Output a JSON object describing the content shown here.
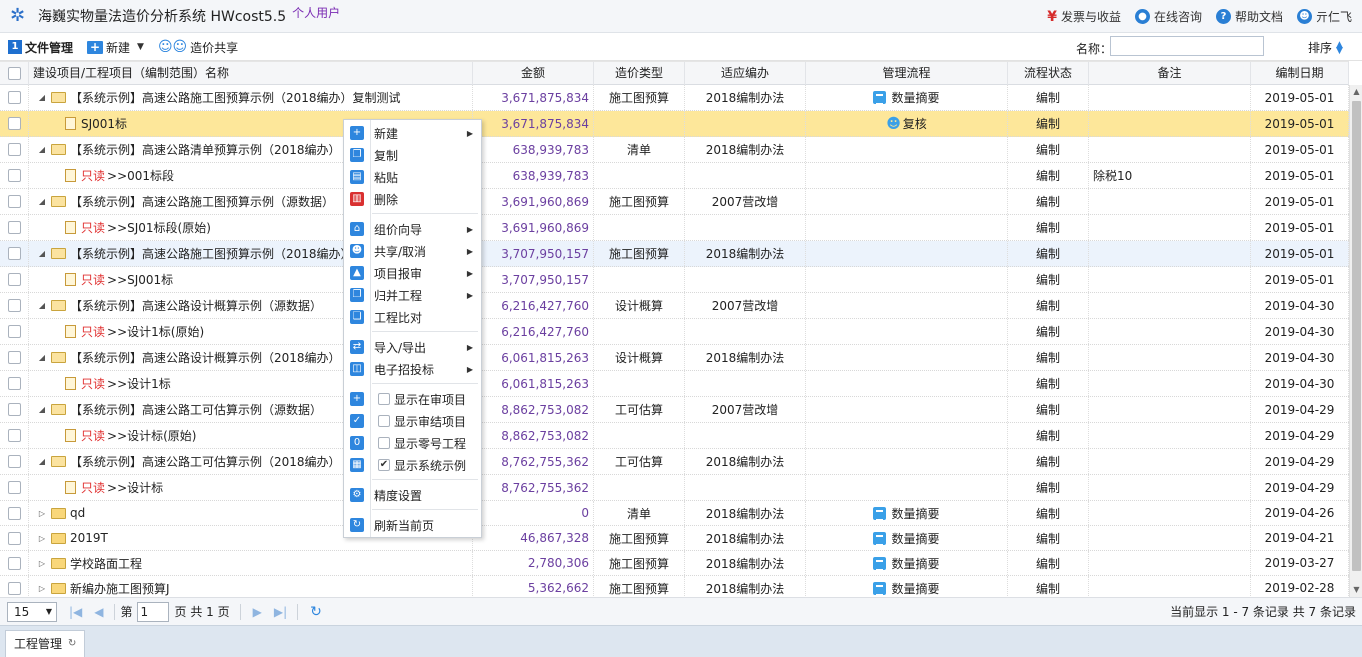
{
  "app": {
    "title": "海巍实物量法造价分析系统 HWcost5.5",
    "user_type": "个人用户",
    "links": [
      {
        "label": "发票与收益",
        "icon": "yen-icon"
      },
      {
        "label": "在线咨询",
        "icon": "chat-icon"
      },
      {
        "label": "帮助文档",
        "icon": "help-icon"
      },
      {
        "label": "亓仁飞",
        "icon": "user-icon"
      }
    ]
  },
  "toolbar": {
    "file_mgmt": "文件管理",
    "new": "新建",
    "share": "造价共享",
    "name_label": "名称：",
    "name_value": "",
    "sort": "排序"
  },
  "columns": {
    "name": "建设项目/工程项目（编制范围）名称",
    "amount": "金额",
    "type": "造价类型",
    "standard": "适应编办",
    "flow": "管理流程",
    "status": "流程状态",
    "note": "备注",
    "date": "编制日期"
  },
  "rows": [
    {
      "level": 0,
      "kind": "folder",
      "open": true,
      "ro": "",
      "name": "【系统示例】高速公路施工图预算示例（2018编办）复制测试",
      "amount": "3,671,875,834",
      "type": "施工图预算",
      "standard": "2018编制办法",
      "flow": "数量摘要",
      "flow_icon": "calc",
      "status": "编制",
      "note": "",
      "date": "2019-05-01"
    },
    {
      "level": 1,
      "kind": "doc",
      "open": false,
      "ro": "",
      "name": "SJ001标",
      "amount": "3,671,875,834",
      "type": "",
      "standard": "",
      "flow": "复核",
      "flow_icon": "user",
      "status": "编制",
      "note": "",
      "date": "2019-05-01",
      "selected": true
    },
    {
      "level": 0,
      "kind": "folder",
      "open": true,
      "ro": "",
      "name": "【系统示例】高速公路清单预算示例（2018编办）",
      "amount": "638,939,783",
      "type": "清单",
      "standard": "2018编制办法",
      "flow": "",
      "flow_icon": "",
      "status": "编制",
      "note": "",
      "date": "2019-05-01"
    },
    {
      "level": 1,
      "kind": "doc",
      "open": false,
      "ro": "只读",
      "name": ">>001标段",
      "amount": "638,939,783",
      "type": "",
      "standard": "",
      "flow": "",
      "flow_icon": "",
      "status": "编制",
      "note": "除税10",
      "date": "2019-05-01"
    },
    {
      "level": 0,
      "kind": "folder",
      "open": true,
      "ro": "",
      "name": "【系统示例】高速公路施工图预算示例（源数据）",
      "amount": "3,691,960,869",
      "type": "施工图预算",
      "standard": "2007营改增",
      "flow": "",
      "flow_icon": "",
      "status": "编制",
      "note": "",
      "date": "2019-05-01"
    },
    {
      "level": 1,
      "kind": "doc",
      "open": false,
      "ro": "只读",
      "name": ">>SJ01标段(原始)",
      "amount": "3,691,960,869",
      "type": "",
      "standard": "",
      "flow": "",
      "flow_icon": "",
      "status": "编制",
      "note": "",
      "date": "2019-05-01"
    },
    {
      "level": 0,
      "kind": "folder",
      "open": true,
      "ro": "",
      "name": "【系统示例】高速公路施工图预算示例（2018编办）",
      "amount": "3,707,950,157",
      "type": "施工图预算",
      "standard": "2018编制办法",
      "flow": "",
      "flow_icon": "",
      "status": "编制",
      "note": "",
      "date": "2019-05-01",
      "hover": true
    },
    {
      "level": 1,
      "kind": "doc",
      "open": false,
      "ro": "只读",
      "name": ">>SJ001标",
      "amount": "3,707,950,157",
      "type": "",
      "standard": "",
      "flow": "",
      "flow_icon": "",
      "status": "编制",
      "note": "",
      "date": "2019-05-01"
    },
    {
      "level": 0,
      "kind": "folder",
      "open": true,
      "ro": "",
      "name": "【系统示例】高速公路设计概算示例（源数据）",
      "amount": "6,216,427,760",
      "type": "设计概算",
      "standard": "2007营改增",
      "flow": "",
      "flow_icon": "",
      "status": "编制",
      "note": "",
      "date": "2019-04-30"
    },
    {
      "level": 1,
      "kind": "doc",
      "open": false,
      "ro": "只读",
      "name": ">>设计1标(原始)",
      "amount": "6,216,427,760",
      "type": "",
      "standard": "",
      "flow": "",
      "flow_icon": "",
      "status": "编制",
      "note": "",
      "date": "2019-04-30"
    },
    {
      "level": 0,
      "kind": "folder",
      "open": true,
      "ro": "",
      "name": "【系统示例】高速公路设计概算示例（2018编办）",
      "amount": "6,061,815,263",
      "type": "设计概算",
      "standard": "2018编制办法",
      "flow": "",
      "flow_icon": "",
      "status": "编制",
      "note": "",
      "date": "2019-04-30"
    },
    {
      "level": 1,
      "kind": "doc",
      "open": false,
      "ro": "只读",
      "name": ">>设计1标",
      "amount": "6,061,815,263",
      "type": "",
      "standard": "",
      "flow": "",
      "flow_icon": "",
      "status": "编制",
      "note": "",
      "date": "2019-04-30"
    },
    {
      "level": 0,
      "kind": "folder",
      "open": true,
      "ro": "",
      "name": "【系统示例】高速公路工可估算示例（源数据）",
      "amount": "8,862,753,082",
      "type": "工可估算",
      "standard": "2007营改增",
      "flow": "",
      "flow_icon": "",
      "status": "编制",
      "note": "",
      "date": "2019-04-29"
    },
    {
      "level": 1,
      "kind": "doc",
      "open": false,
      "ro": "只读",
      "name": ">>设计标(原始)",
      "amount": "8,862,753,082",
      "type": "",
      "standard": "",
      "flow": "",
      "flow_icon": "",
      "status": "编制",
      "note": "",
      "date": "2019-04-29"
    },
    {
      "level": 0,
      "kind": "folder",
      "open": true,
      "ro": "",
      "name": "【系统示例】高速公路工可估算示例（2018编办）",
      "amount": "8,762,755,362",
      "type": "工可估算",
      "standard": "2018编制办法",
      "flow": "",
      "flow_icon": "",
      "status": "编制",
      "note": "",
      "date": "2019-04-29"
    },
    {
      "level": 1,
      "kind": "doc",
      "open": false,
      "ro": "只读",
      "name": ">>设计标",
      "amount": "8,762,755,362",
      "type": "",
      "standard": "",
      "flow": "",
      "flow_icon": "",
      "status": "编制",
      "note": "",
      "date": "2019-04-29"
    },
    {
      "level": 0,
      "kind": "folder",
      "open": false,
      "ro": "",
      "name": "qd",
      "amount": "0",
      "type": "清单",
      "standard": "2018编制办法",
      "flow": "数量摘要",
      "flow_icon": "calc",
      "status": "编制",
      "note": "",
      "date": "2019-04-26"
    },
    {
      "level": 0,
      "kind": "folder",
      "open": false,
      "ro": "",
      "name": "2019T",
      "amount": "46,867,328",
      "type": "施工图预算",
      "standard": "2018编制办法",
      "flow": "数量摘要",
      "flow_icon": "calc",
      "status": "编制",
      "note": "",
      "date": "2019-04-21"
    },
    {
      "level": 0,
      "kind": "folder",
      "open": false,
      "ro": "",
      "name": "学校路面工程",
      "amount": "2,780,306",
      "type": "施工图预算",
      "standard": "2018编制办法",
      "flow": "数量摘要",
      "flow_icon": "calc",
      "status": "编制",
      "note": "",
      "date": "2019-03-27"
    },
    {
      "level": 0,
      "kind": "folder",
      "open": false,
      "ro": "",
      "name": "新编办施工图预算J",
      "amount": "5,362,662",
      "type": "施工图预算",
      "standard": "2018编制办法",
      "flow": "数量摘要",
      "flow_icon": "calc",
      "status": "编制",
      "note": "",
      "date": "2019-02-28"
    }
  ],
  "context_menu": {
    "items": [
      {
        "label": "新建",
        "icon": "plus-box-icon",
        "sub": true
      },
      {
        "label": "复制",
        "icon": "copy-icon",
        "sub": false
      },
      {
        "label": "粘贴",
        "icon": "paste-icon",
        "sub": false
      },
      {
        "label": "删除",
        "icon": "trash-icon",
        "sub": false
      },
      {
        "label": "组价向导",
        "icon": "map-icon",
        "sub": true
      },
      {
        "label": "共享/取消",
        "icon": "share-users-icon",
        "sub": true
      },
      {
        "label": "项目报审",
        "icon": "report-icon",
        "sub": true
      },
      {
        "label": "归并工程",
        "icon": "merge-icon",
        "sub": true
      },
      {
        "label": "工程比对",
        "icon": "compare-icon",
        "sub": false
      },
      {
        "label": "导入/导出",
        "icon": "import-export-icon",
        "sub": true
      },
      {
        "label": "电子招投标",
        "icon": "bid-icon",
        "sub": true
      },
      {
        "label": "显示在审项目",
        "icon": "calendar-plus-icon",
        "checkbox": true,
        "checked": false
      },
      {
        "label": "显示审结项目",
        "icon": "calendar-check-icon",
        "checkbox": true,
        "checked": false
      },
      {
        "label": "显示零号工程",
        "icon": "zero-icon",
        "checkbox": true,
        "checked": false
      },
      {
        "label": "显示系统示例",
        "icon": "calendar-icon",
        "checkbox": true,
        "checked": true
      },
      {
        "label": "精度设置",
        "icon": "gears-icon",
        "sub": false
      },
      {
        "label": "刷新当前页",
        "icon": "refresh-icon",
        "sub": false
      }
    ]
  },
  "pager": {
    "page_size": "15",
    "page_prefix": "第",
    "page": "1",
    "page_suffix": "页 共 1 页",
    "info": "当前显示 1 - 7 条记录 共 7 条记录"
  },
  "bottom_tab": {
    "label": "工程管理"
  },
  "colors": {
    "accent": "#2e86de",
    "selected_row": "#fde79a",
    "readonly": "#e03030",
    "amount": "#6b3fa0"
  }
}
